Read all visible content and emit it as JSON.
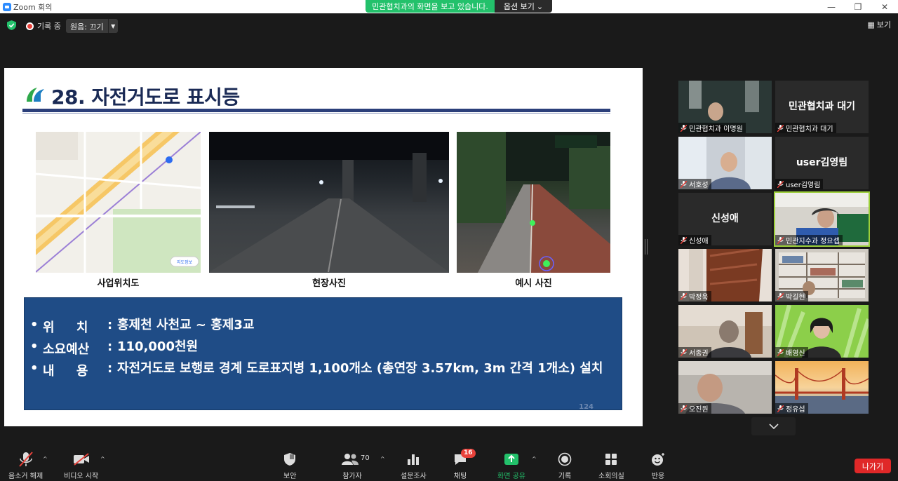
{
  "window": {
    "title": "Zoom 회의",
    "controls": [
      "—",
      "❐",
      "✕"
    ]
  },
  "share_banner": {
    "message": "민관협치과의 화면을 보고 있습니다.",
    "options_label": "옵션 보기"
  },
  "topbar": {
    "recording_label": "기록 중",
    "audio_label": "원음: 끄기",
    "view_label": "보기"
  },
  "slide": {
    "title": "28. 자전거도로 표시등",
    "captions": [
      "사업위치도",
      "현장사진",
      "예시 사진"
    ],
    "map_sign": "지도정보",
    "info": [
      {
        "bullet": "•",
        "key": "위     치",
        "value": "홍제천 사천교 ~ 홍제3교"
      },
      {
        "bullet": "•",
        "key": "소요예산",
        "value": "110,000천원"
      },
      {
        "bullet": "•",
        "key": "내     용",
        "value": "자전거도로 보행로 경계 도로표지병 1,100개소 (총연장 3.57km, 3m 간격 1개소) 설치"
      }
    ],
    "page_number": "124"
  },
  "participants": [
    {
      "name": "민관협치과 이명원",
      "big": "",
      "video": "office"
    },
    {
      "name": "민관협치과 대기",
      "big": "민관협치과 대기",
      "video": "none"
    },
    {
      "name": "서호성",
      "big": "",
      "video": "curtain"
    },
    {
      "name": "user김영림",
      "big": "user김영림",
      "video": "none"
    },
    {
      "name": "신성애",
      "big": "신성애",
      "video": "none"
    },
    {
      "name": "민관지수과 정요셉",
      "big": "",
      "video": "banner",
      "active": true
    },
    {
      "name": "박정욱",
      "big": "",
      "video": "wood"
    },
    {
      "name": "박길현",
      "big": "",
      "video": "shelf"
    },
    {
      "name": "서종권",
      "big": "",
      "video": "room"
    },
    {
      "name": "배영신",
      "big": "",
      "video": "green"
    },
    {
      "name": "오진원",
      "big": "",
      "video": "gray"
    },
    {
      "name": "정유섭",
      "big": "",
      "video": "bridge"
    }
  ],
  "toolbar": {
    "unmute": "음소거 해제",
    "video_start": "비디오 시작",
    "security": "보안",
    "participants": "참가자",
    "participant_count": "70",
    "polls": "설문조사",
    "chat": "채팅",
    "chat_badge": "16",
    "share_screen": "화면 공유",
    "record": "기록",
    "breakout": "소회의실",
    "reactions": "반응",
    "leave": "나가기"
  },
  "colors": {
    "share_green": "#23c16b",
    "leave_red": "#e02828",
    "slide_box": "#1f4c86",
    "active_speaker": "#9ccf3a"
  }
}
